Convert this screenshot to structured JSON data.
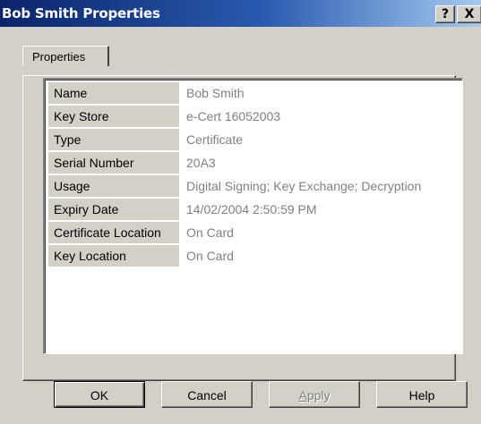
{
  "window": {
    "title": "Bob Smith Properties",
    "help_glyph": "?",
    "close_glyph": "X"
  },
  "tabs": [
    {
      "label": "Properties",
      "active": true
    }
  ],
  "properties": [
    {
      "label": "Name",
      "value": "Bob Smith"
    },
    {
      "label": "Key Store",
      "value": "e-Cert 16052003"
    },
    {
      "label": "Type",
      "value": "Certificate"
    },
    {
      "label": "Serial Number",
      "value": "20A3"
    },
    {
      "label": "Usage",
      "value": "Digital Signing; Key Exchange; Decryption"
    },
    {
      "label": "Expiry Date",
      "value": "14/02/2004 2:50:59 PM"
    },
    {
      "label": "Certificate Location",
      "value": "On Card"
    },
    {
      "label": "Key Location",
      "value": "On Card"
    }
  ],
  "buttons": {
    "ok": "OK",
    "cancel": "Cancel",
    "apply_first": "A",
    "apply_rest": "pply",
    "help": "Help"
  },
  "colors": {
    "titlebar_start": "#0a246a",
    "titlebar_end": "#a6caf0",
    "face": "#d4d0c8",
    "value_text": "#808080"
  }
}
